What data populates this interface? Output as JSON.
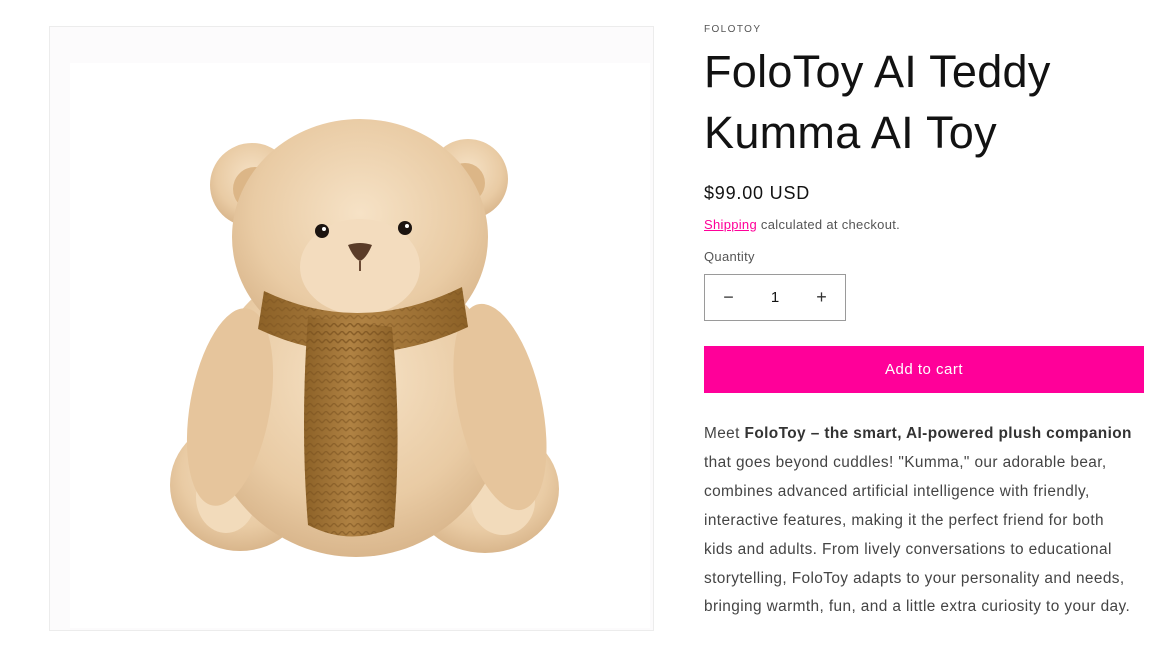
{
  "product": {
    "vendor": "FOLOTOY",
    "title": "FoloToy AI Teddy Kumma AI Toy",
    "price": "$99.00 USD",
    "image_alt": "Plush teddy bear with brown knitted scarf"
  },
  "shipping": {
    "link_text": "Shipping",
    "rest_text": "calculated at checkout."
  },
  "quantity": {
    "label": "Quantity",
    "value": "1",
    "decrement_symbol": "−",
    "increment_symbol": "+"
  },
  "cart": {
    "add_label": "Add to cart"
  },
  "description": {
    "lead": "Meet",
    "bold": "FoloToy – the smart, AI-powered plush companion",
    "body": "that goes beyond cuddles! \"Kumma,\" our adorable bear, combines advanced artificial intelligence with friendly, interactive features, making it the perfect friend for both kids and adults. From lively conversations to educational storytelling, FoloToy adapts to your personality and needs, bringing warmth, fun, and a little extra curiosity to your day."
  },
  "colors": {
    "accent": "#ff0099",
    "bear_fur": "#e9cca6",
    "scarf": "#a47536"
  }
}
